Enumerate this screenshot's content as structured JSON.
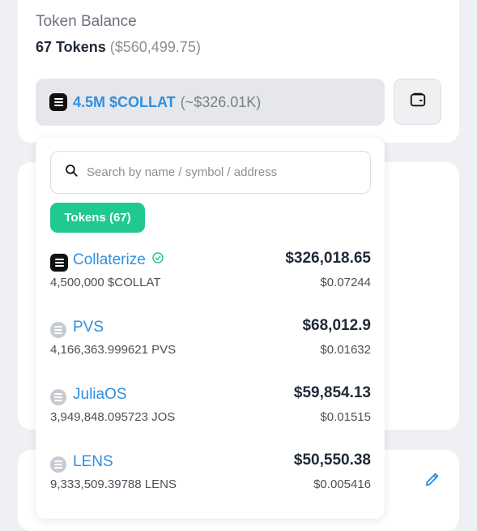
{
  "balance": {
    "label": "Token Balance",
    "count_text": "67 Tokens",
    "usd_text": "($560,499.75)"
  },
  "selector": {
    "amount_text": "4.5M $COLLAT",
    "usd_text": "(~$326.01K)"
  },
  "search": {
    "placeholder": "Search by name / symbol / address",
    "value": ""
  },
  "tokens_chip": {
    "label": "Tokens (67)"
  },
  "tokens": [
    {
      "name": "Collaterize",
      "amount": "4,500,000 $COLLAT",
      "value": "$326,018.65",
      "price": "$0.07244",
      "verified": true,
      "icon": "collateral-logo-icon"
    },
    {
      "name": "PVS",
      "amount": "4,166,363.999621 PVS",
      "value": "$68,012.9",
      "price": "$0.01632",
      "verified": false,
      "icon": "generic-token-icon"
    },
    {
      "name": "JuliaOS",
      "amount": "3,949,848.095723 JOS",
      "value": "$59,854.13",
      "price": "$0.01515",
      "verified": false,
      "icon": "generic-token-icon"
    },
    {
      "name": "LENS",
      "amount": "9,333,509.39788 LENS",
      "value": "$50,550.38",
      "price": "$0.005416",
      "verified": false,
      "icon": "generic-token-icon"
    }
  ],
  "colors": {
    "accent_blue": "#2f8fe0",
    "chip_green": "#1fc98f",
    "verified_green": "#1fc98f"
  }
}
